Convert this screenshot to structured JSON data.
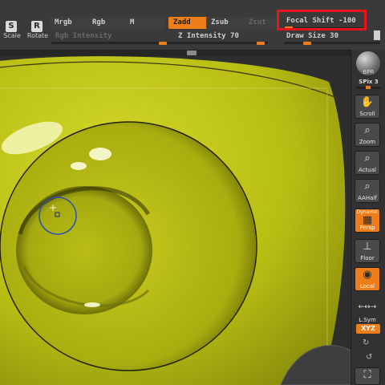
{
  "toolbar": {
    "scale_label": "Scale",
    "scale_letter": "S",
    "rotate_label": "Rotate",
    "rotate_letter": "R",
    "mrgb_label": "Mrgb",
    "rgb_label": "Rgb",
    "m_label": "M",
    "rgb_intensity_label": "Rgb Intensity",
    "zadd_label": "Zadd",
    "zsub_label": "Zsub",
    "zcut_label": "Zcut",
    "z_intensity_label": "Z Intensity 70",
    "z_intensity_value": 70,
    "focal_shift_label": "Focal Shift -100",
    "focal_shift_value": -100,
    "draw_size_label": "Draw Size 30",
    "draw_size_value": 30
  },
  "right_panel": {
    "bpr_label": "BPR",
    "spix_label": "SPix 3",
    "scroll_label": "Scroll",
    "zoom_label": "Zoom",
    "actual_label": "Actual",
    "aahalf_label": "AAHalf",
    "dynamic_label": "Dynamic",
    "persp_label": "Persp",
    "floor_label": "Floor",
    "local_label": "Local",
    "lsym_label": "L.Sym",
    "xyz_label": "XYZ"
  },
  "colors": {
    "accent": "#ee7e1a",
    "highlight_box": "#e8141c",
    "model_yellow": "#b8bd14",
    "background": "#2b2b2b"
  },
  "icons": {
    "scale": "scale-icon",
    "rotate": "rotate-icon",
    "scroll": "hand-icon",
    "zoom": "magnifier-icon",
    "persp": "grid-icon",
    "local": "target-icon"
  }
}
